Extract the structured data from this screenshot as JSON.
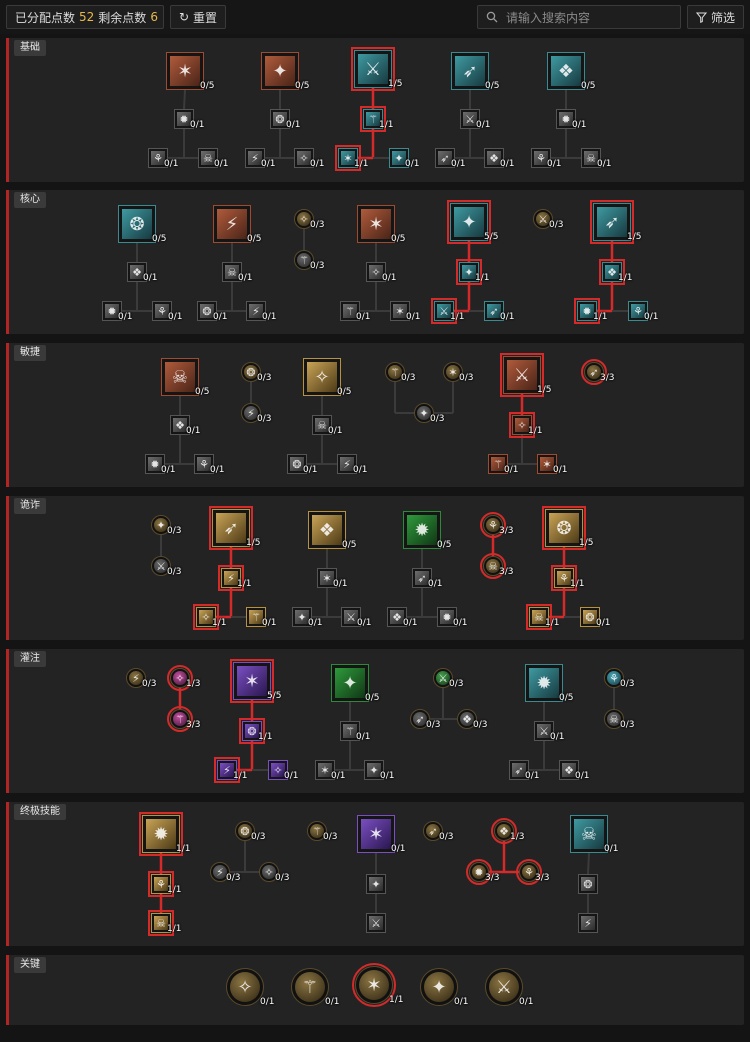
{
  "topbar": {
    "allocated_label": "已分配点数",
    "allocated_value": "52",
    "remaining_label": "剩余点数",
    "remaining_value": "6",
    "reset_label": "重置",
    "search_placeholder": "请输入搜索内容",
    "filter_label": "筛选"
  },
  "sections": [
    {
      "key": "basic",
      "title": "基础"
    },
    {
      "key": "core",
      "title": "核心"
    },
    {
      "key": "agility",
      "title": "敏捷"
    },
    {
      "key": "subterfuge",
      "title": "诡诈"
    },
    {
      "key": "imbuement",
      "title": "灌注"
    },
    {
      "key": "ultimate",
      "title": "终极技能"
    },
    {
      "key": "key",
      "title": "关键"
    }
  ],
  "colors": {
    "accent": "#d42a2a",
    "gold": "#e6b84a"
  },
  "nodes": {
    "basic_1": "0/5",
    "basic_2": "0/5",
    "basic_3": "1/5",
    "basic_4": "0/5",
    "basic_5": "0/5",
    "basic_1a": "0/1",
    "basic_1b": "0/1",
    "basic_1c": "0/1",
    "basic_2a": "0/1",
    "basic_2b": "0/1",
    "basic_2c": "0/1",
    "basic_3a": "1/1",
    "basic_3b": "1/1",
    "basic_3c": "0/1",
    "basic_4a": "0/1",
    "basic_4b": "0/1",
    "basic_4c": "0/1",
    "basic_5a": "0/1",
    "basic_5b": "0/1",
    "basic_5c": "0/1",
    "core_1": "0/5",
    "core_2": "0/5",
    "core_p1": "0/3",
    "core_p1b": "0/3",
    "core_3": "0/5",
    "core_4": "5/5",
    "core_p2": "0/3",
    "core_5": "1/5",
    "core_1a": "0/1",
    "core_1b": "0/1",
    "core_1c": "0/1",
    "core_2a": "0/1",
    "core_2b": "0/1",
    "core_2c": "0/1",
    "core_3a": "0/1",
    "core_3b": "0/1",
    "core_3c": "0/1",
    "core_4a": "1/1",
    "core_4b": "1/1",
    "core_4c": "0/1",
    "core_5a": "1/1",
    "core_5b": "1/1",
    "core_5c": "0/1",
    "agi_1": "0/5",
    "agi_p1": "0/3",
    "agi_p1b": "0/3",
    "agi_2": "0/5",
    "agi_p2": "0/3",
    "agi_p3": "0/3",
    "agi_p23": "0/3",
    "agi_3": "1/5",
    "agi_p4": "3/3",
    "agi_1a": "0/1",
    "agi_1b": "0/1",
    "agi_1c": "0/1",
    "agi_2a": "0/1",
    "agi_2b": "0/1",
    "agi_2c": "0/1",
    "agi_3a": "1/1",
    "agi_3b": "0/1",
    "agi_3c": "0/1",
    "sub_p1": "0/3",
    "sub_p1b": "0/3",
    "sub_1": "1/5",
    "sub_2": "0/5",
    "sub_3": "0/5",
    "sub_p2": "3/3",
    "sub_p2b": "3/3",
    "sub_4": "1/5",
    "sub_1a": "1/1",
    "sub_1b": "1/1",
    "sub_1c": "0/1",
    "sub_2a": "0/1",
    "sub_2b": "0/1",
    "sub_2c": "0/1",
    "sub_3a": "0/1",
    "sub_3b": "0/1",
    "sub_3c": "0/1",
    "sub_4a": "1/1",
    "sub_4b": "1/1",
    "sub_4c": "0/1",
    "imb_p1": "0/3",
    "imb_p2": "1/3",
    "imb_p2b": "3/3",
    "imb_1": "5/5",
    "imb_2": "0/5",
    "imb_p3": "0/3",
    "imb_p3a": "0/3",
    "imb_p3b": "0/3",
    "imb_3": "0/5",
    "imb_p4": "0/3",
    "imb_p4b": "0/3",
    "imb_1a": "1/1",
    "imb_1b": "1/1",
    "imb_1c": "0/1",
    "imb_2a": "0/1",
    "imb_2b": "0/1",
    "imb_2c": "0/1",
    "imb_3a": "0/1",
    "imb_3b": "0/1",
    "imb_3c": "0/1",
    "ult_1": "1/1",
    "ult_1a": "1/1",
    "ult_1b": "1/1",
    "ult_p1": "0/3",
    "ult_p1a": "0/3",
    "ult_p1b": "0/3",
    "ult_p2": "0/3",
    "ult_2": "0/1",
    "ult_2a": "",
    "ult_2b": "",
    "ult_p3": "0/3",
    "ult_p4": "1/3",
    "ult_p4a": "3/3",
    "ult_p4b": "3/3",
    "ult_3": "0/1",
    "ult_3a": "",
    "ult_3b": "",
    "key_1": "0/1",
    "key_2": "0/1",
    "key_3": "1/1",
    "key_4": "0/1",
    "key_5": "0/1"
  }
}
